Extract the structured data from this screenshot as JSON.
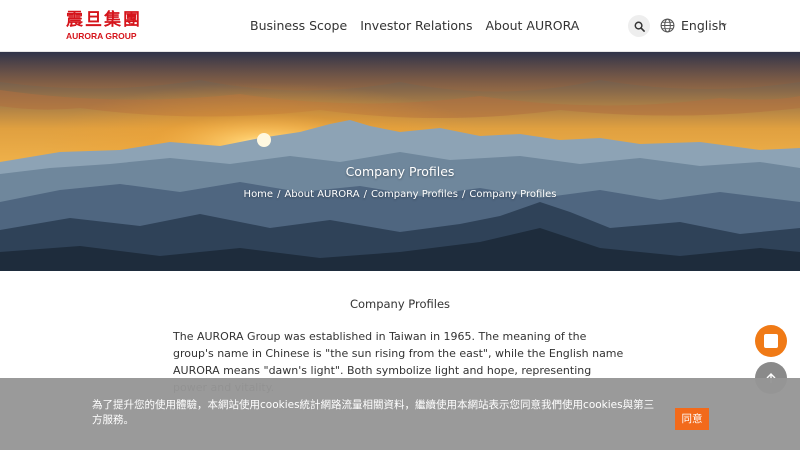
{
  "logo": {
    "chinese": "震旦集團",
    "english": "AURORA GROUP"
  },
  "nav": {
    "items": [
      {
        "label": "Business Scope"
      },
      {
        "label": "Investor Relations"
      },
      {
        "label": "About AURORA"
      }
    ]
  },
  "header": {
    "search_icon": "search-icon",
    "globe_icon": "globe-icon",
    "language": "English"
  },
  "hero": {
    "title": "Company Profiles",
    "breadcrumb": [
      "Home",
      "About AURORA",
      "Company Profiles",
      "Company Profiles"
    ],
    "separator": "/"
  },
  "content": {
    "title": "Company Profiles",
    "paragraph": "The AURORA Group was established in Taiwan in 1965. The meaning of the group's name in Chinese is \"the sun rising from the east\", while the English name AURORA means \"dawn's light\". Both symbolize light and hope, representing power and vitality."
  },
  "floating": {
    "primary_icon": "square-icon",
    "top_icon": "arrow-up-icon"
  },
  "cookie": {
    "text": "為了提升您的使用體驗，本網站使用cookies統計網路流量相關資料，繼續使用本網站表示您同意我們使用cookies與第三方服務。",
    "agree_label": "同意"
  },
  "colors": {
    "brand_red": "#d5141b",
    "accent_orange": "#f07a16",
    "cookie_bg": "#969696"
  }
}
